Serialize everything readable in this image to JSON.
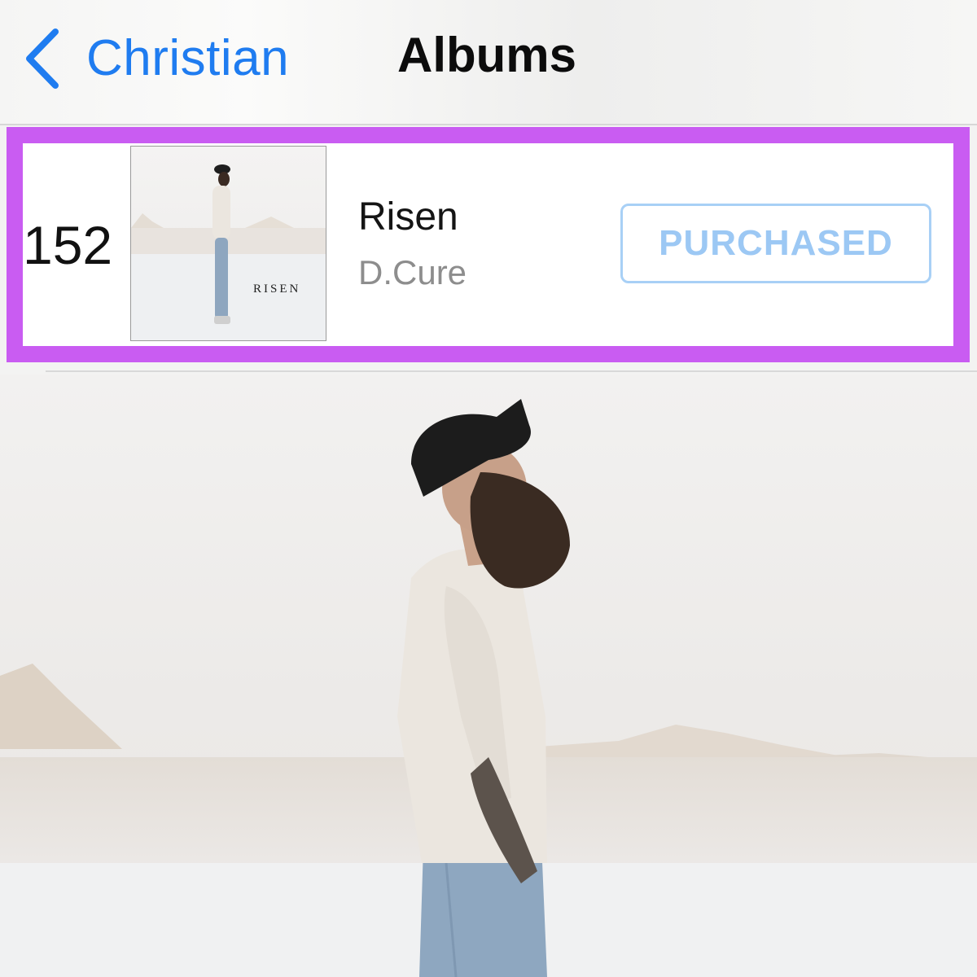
{
  "nav": {
    "back_label": "Christian",
    "title": "Albums",
    "back_icon": "chevron-left-icon"
  },
  "album": {
    "rank": "152",
    "title": "Risen",
    "artist": "D.Cure",
    "status_button": "PURCHASED",
    "artwork_text": "RISEN"
  },
  "colors": {
    "accent_blue": "#1f7cf0",
    "highlight_border": "#c95cf2",
    "purchased_text": "#9cc8f4",
    "purchased_border": "#a8d0f6"
  }
}
